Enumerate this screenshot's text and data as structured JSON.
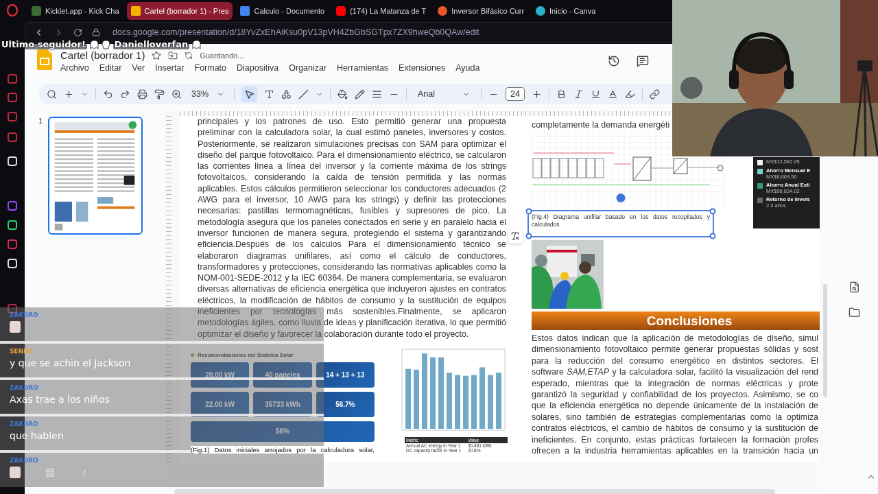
{
  "browser": {
    "tabs": [
      {
        "title": "Kicklet.app - Kick Cha",
        "selected": false
      },
      {
        "title": "Cartel (borrador 1) - Pres",
        "selected": true
      },
      {
        "title": "Calculo - Documento",
        "selected": false
      },
      {
        "title": "(174) La Matanza de T",
        "selected": false
      },
      {
        "title": "Inversor Bifásico Curr",
        "selected": false
      },
      {
        "title": "Inicio - Canva",
        "selected": false
      }
    ],
    "address": "docs.google.com/presentation/d/18YvZxEhAiKsu0pV13pVH4ZbGbSGTpx7ZX9hweQb0QAw/edit"
  },
  "banner": {
    "label": "Ultimo seguidor!",
    "follower": "Danielloverfan"
  },
  "slides": {
    "title": "Cartel (borrador 1)",
    "save_status": "Guardando...",
    "menu": [
      "Archivo",
      "Editar",
      "Ver",
      "Insertar",
      "Formato",
      "Diapositiva",
      "Organizar",
      "Herramientas",
      "Extensiones",
      "Ayuda"
    ],
    "toolbar": {
      "zoom": "33%",
      "select_tool": {
        "selected": true
      },
      "font": "Arial",
      "font_size": "24"
    },
    "filmstrip": [
      {
        "number": "1",
        "selected": true
      }
    ]
  },
  "slide": {
    "paragraph_lines": [
      "principales y los patrones de uso. Esto permitió generar una propuesta",
      "preliminar con la calculadora solar, la cual estimó paneles, inversores y costos.",
      "Posteriormente, se realizaron simulaciones precisas con SAM para optimizar el",
      "diseño del parque fotovoltaico. Para el dimensionamiento eléctrico, se calcularon",
      "las corrientes línea a línea del inversor y la corriente máxima de los strings",
      "fotovoltaicos, considerando la caída de tensión permitida y las normas",
      "aplicables. Estos cálculos permitieron seleccionar los conductores adecuados (2",
      "AWG para el inversor, 10 AWG para los strings) y definir las protecciones",
      "necesarias: pastillas termomagnéticas, fusibles y supresores de pico. La",
      "metodología asegura que los paneles conectados en serie y en paralelo hacia el",
      "inversor funcionen de manera segura, protegiendo el sistema y garantizando",
      "eficiencia.Después de los calculos Para el dimensionamiento técnico se",
      "elaboraron diagramas unifilares, así como el cálculo de conductores,",
      "transformadores y protecciones, considerando las normativas aplicables como la",
      "NOM-001-SEDE-2012 y la IEC 60364. De manera complementaria, se evaluaron",
      "diversas alternativas de eficiencia energética que incluyeron ajustes en contratos",
      "eléctricos, la modificación de hábitos de consumo y la sustitución de equipos",
      "ineficientes por tecnologías más sostenibles.Finalmente, se aplicaron",
      "metodologías ágiles, como lluvia de ideas y planificación iterativa, lo que permitió",
      "optimizar el diseño y favorecer la colaboración durante todo el proyecto."
    ],
    "recommendations": {
      "title": "Recomendaciones del Sistema Solar",
      "tiles": [
        "20.00 kW",
        "40 paneles",
        "14 + 13 + 13",
        "22.00 kW",
        "35733 kWh",
        "56.7%",
        "56%"
      ],
      "caption": "(Fig.1) Datos iniciales arrojados por la calculadora solar,"
    },
    "energy_table": {
      "headers": [
        "Metric",
        "Value"
      ],
      "rows": [
        [
          "Annual AC energy in Year 1",
          "30,481 kWh"
        ],
        [
          "DC capacity factor in Year 1",
          "20.8%"
        ]
      ]
    },
    "top_line": "completamente la demanda energéti",
    "fig4_caption": "(Fig.4) Diagrama unifilar basado en los datos recopilados y calculados",
    "legend": [
      {
        "value": "MX$12,582.05",
        "color": "#f2f2f2"
      },
      {
        "label": "Ahorro Mensual E",
        "value": "MX$8,069.50",
        "color": "#6fd3cb"
      },
      {
        "label": "Ahorro Anual Esti",
        "value": "MX$96,834.02",
        "color": "#3c9a77"
      },
      {
        "label": "Retorno de Invers",
        "value": "2.3 años",
        "color": "#6a6a6a"
      }
    ],
    "conclusions": {
      "title": "Conclusiones",
      "lines": [
        "Estos datos indican que la aplicación de metodologías de diseño, simul",
        "dimensionamiento fotovoltaico permite generar propuestas sólidas y sost",
        "para la reducción del consumo energético en distintos sectores. El",
        "software *SAM,ETAP* y la calculadora solar, facilitó la visualización del rend",
        "esperado, mientras que la integración de normas eléctricas y prote",
        "garantizó la seguridad y confiabilidad de los proyectos. Asimismo, se co",
        "que la eficiencia energética no depende únicamente de la instalación de",
        "solares, sino también de estrategias complementarias como la optimiza",
        "contratos eléctricos, el cambio de hábitos de consumo y la sustitución de",
        "ineficientes. En conjunto, estas prácticas fortalecen la formación profes",
        "ofrecen a la industria herramientas aplicables en la transición hacia un"
      ]
    }
  },
  "chat": [
    {
      "user": "ZAKIIRO",
      "color": "#3f74d8",
      "avatar": true
    },
    {
      "user": "SENDA",
      "color": "#e9a53a",
      "message": "y que se achin el Jackson"
    },
    {
      "user": "ZAKIIRO",
      "color": "#3f74d8",
      "message": "Axas trae a los niños"
    },
    {
      "user": "ZAKIIRO",
      "color": "#3f74d8",
      "message": "que hablen"
    },
    {
      "user": "ZAKIIRO",
      "color": "#3f74d8",
      "avatar": true
    }
  ]
}
